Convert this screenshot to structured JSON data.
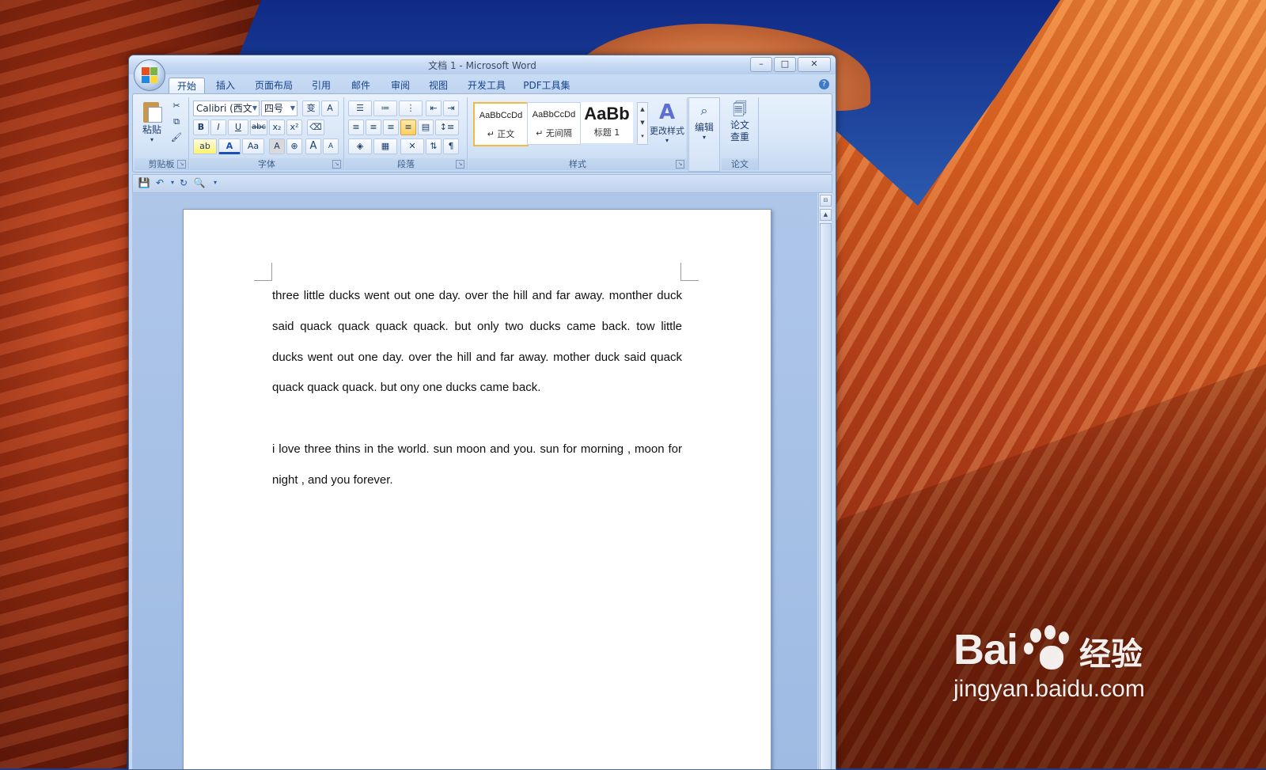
{
  "window": {
    "title": "文档 1 - Microsoft Word",
    "controls": {
      "minimize": "–",
      "maximize": "□",
      "close": "✕"
    }
  },
  "tabs": [
    "开始",
    "插入",
    "页面布局",
    "引用",
    "邮件",
    "审阅",
    "视图",
    "开发工具",
    "PDF工具集"
  ],
  "ribbon": {
    "clipboard": {
      "label": "剪贴板",
      "paste": "粘贴"
    },
    "font": {
      "label": "字体",
      "font_name": "Calibri (西文",
      "font_size": "四号",
      "bold": "B",
      "italic": "I",
      "underline": "U",
      "strikethrough": "abc",
      "subscript": "x₂",
      "superscript": "x²",
      "change_case": "Aa",
      "grow": "A",
      "shrink": "A"
    },
    "paragraph": {
      "label": "段落"
    },
    "styles": {
      "label": "样式",
      "items": [
        {
          "sample": "AaBbCcDd",
          "name": "↵ 正文"
        },
        {
          "sample": "AaBbCcDd",
          "name": "↵ 无间隔"
        },
        {
          "sample": "AaBb",
          "name": "标题 1"
        }
      ],
      "change_styles": "更改样式"
    },
    "editing": {
      "label": "编辑"
    },
    "paper": {
      "label": "论文",
      "check_line1": "论文",
      "check_line2": "查重"
    }
  },
  "document": {
    "paragraphs": [
      "three little ducks went out one day. over the hill and far away. monther duck said quack quack quack quack. but only two ducks came back. tow little ducks went out one day. over the hill and far away. mother duck said quack quack quack quack. but ony one ducks came back.",
      "i love three thins in the world. sun moon and you. sun for morning , moon for night , and you forever."
    ]
  },
  "watermark": {
    "brand": "Bai",
    "brand_cn": "经验",
    "url": "jingyan.baidu.com"
  }
}
